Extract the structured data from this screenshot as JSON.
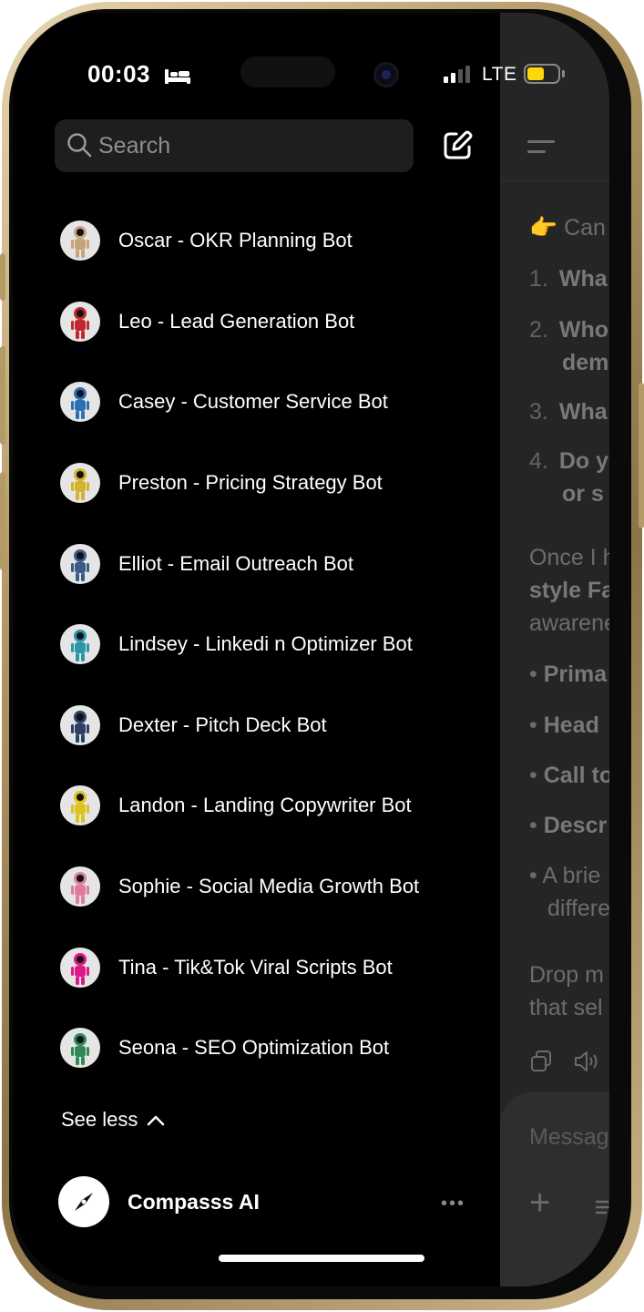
{
  "status_bar": {
    "time": "00:03",
    "network": "LTE",
    "battery_color": "#ffd60a"
  },
  "search": {
    "placeholder": "Search"
  },
  "bots": [
    {
      "label": "Oscar - OKR Planning Bot",
      "color": "#c9a27a"
    },
    {
      "label": "Leo - Lead Generation Bot",
      "color": "#c0282d"
    },
    {
      "label": "Casey - Customer Service Bot",
      "color": "#2d6fb0"
    },
    {
      "label": "Preston - Pricing Strategy Bot",
      "color": "#d4b22a"
    },
    {
      "label": "Elliot - Email Outreach Bot",
      "color": "#3a5a88"
    },
    {
      "label": "Lindsey - Linkedi n Optimizer Bot",
      "color": "#2a96a6"
    },
    {
      "label": "Dexter - Pitch Deck Bot",
      "color": "#2c3f66"
    },
    {
      "label": "Landon - Landing Copywriter Bot",
      "color": "#e0c21e"
    },
    {
      "label": "Sophie - Social Media Growth Bot",
      "color": "#e07aa0"
    },
    {
      "label": "Tina - Tik&Tok Viral Scripts Bot",
      "color": "#e0198a"
    },
    {
      "label": "Seona - SEO Optimization Bot",
      "color": "#2f8a58"
    }
  ],
  "see_less": "See less",
  "account": {
    "name": "Compasss AI"
  },
  "chat_preview": {
    "line1": "Can",
    "items": [
      {
        "num": "1.",
        "text": "Wha"
      },
      {
        "num": "2.",
        "text": "Who"
      },
      {
        "num": "",
        "text": "dem"
      },
      {
        "num": "3.",
        "text": "Wha"
      },
      {
        "num": "4.",
        "text": "Do y"
      },
      {
        "num": "",
        "text": "or s"
      }
    ],
    "para1": [
      "Once I h",
      "style Fa",
      "awarene"
    ],
    "bullets": [
      "Prima",
      "Head",
      "Call to",
      "Descr"
    ],
    "bullet_plain": [
      "A brie",
      "differe"
    ],
    "para2": [
      "Drop m",
      "that sel"
    ],
    "input_placeholder": "Messag"
  }
}
